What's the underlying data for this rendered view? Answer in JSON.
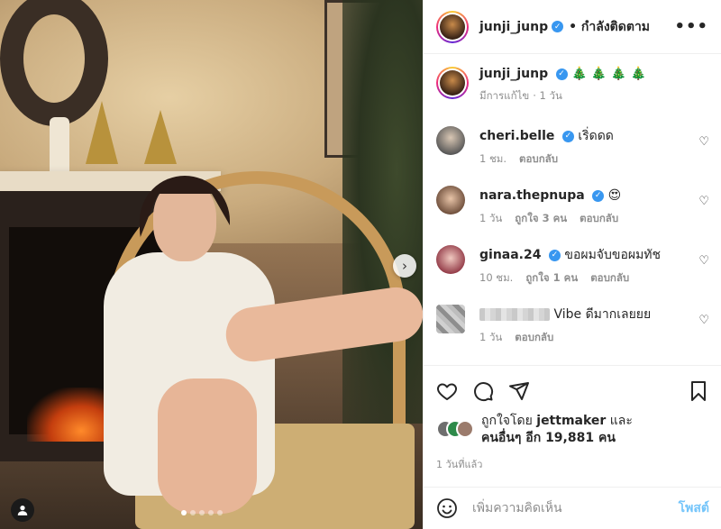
{
  "post": {
    "author": "junji_junp",
    "follow_label": "• กำลังติดตาม",
    "more_label": "•••",
    "caption_emojis": "🎄 🎄 🎄 🎄",
    "caption_edited": "มีการแก้ไข",
    "caption_time": "· 1 วัน"
  },
  "comments": [
    {
      "user": "cheri.belle",
      "verified": true,
      "text": "เริ่ดดด",
      "time": "1 ชม.",
      "likes": "",
      "reply": "ตอบกลับ"
    },
    {
      "user": "nara.thepnupa",
      "verified": true,
      "text": "😍",
      "time": "1 วัน",
      "likes": "ถูกใจ 3 คน",
      "reply": "ตอบกลับ"
    },
    {
      "user": "ginaa.24",
      "verified": true,
      "text": "ขอผมจับขอผมทัช",
      "time": "10 ชม.",
      "likes": "ถูกใจ 1 คน",
      "reply": "ตอบกลับ"
    },
    {
      "user": "",
      "verified": false,
      "text": "Vibe ดีมากเลยยย",
      "time": "1 วัน",
      "likes": "",
      "reply": "ตอบกลับ"
    }
  ],
  "likes": {
    "prefix": "ถูกใจโดย",
    "first_user": "jettmaker",
    "and": "และ",
    "others": "คนอื่นๆ อีก 19,881 คน"
  },
  "posted_time": "1 วันที่แล้ว",
  "add_comment": {
    "placeholder": "เพิ่มความคิดเห็น",
    "post_label": "โพสต์"
  },
  "carousel": {
    "count": 5,
    "active": 1
  },
  "colors": {
    "verified": "#3897f0",
    "link": "#0095f6",
    "secondary_text": "#8e8e8e"
  },
  "icons": [
    "heart-icon",
    "comment-icon",
    "share-icon",
    "bookmark-icon",
    "emoji-icon",
    "chevron-right-icon",
    "user-tag-icon"
  ]
}
